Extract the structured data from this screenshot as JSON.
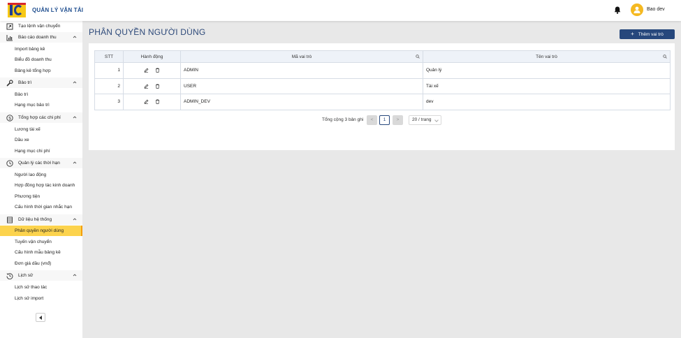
{
  "header": {
    "app_title": "QUẢN LÝ VẬN TẢI",
    "user_name": "Bao dev"
  },
  "sidebar": {
    "top_item": {
      "label": "Tạo lệnh vận chuyển",
      "icon": "export-icon"
    },
    "groups": [
      {
        "label": "Báo cáo doanh thu",
        "icon": "bar-chart-icon",
        "items": [
          "Import bảng kê",
          "Biểu đồ doanh thu",
          "Bảng kê tổng hợp"
        ]
      },
      {
        "label": "Bảo trì",
        "icon": "tool-icon",
        "items": [
          "Bảo trì",
          "Hạng mục bảo trì"
        ]
      },
      {
        "label": "Tổng hợp các chi phí",
        "icon": "dollar-icon",
        "items": [
          "Lương tài xế",
          "Dầu xe",
          "Hạng mục chi phí"
        ]
      },
      {
        "label": "Quản lý các thời hạn",
        "icon": "clock-icon",
        "items": [
          "Người lao động",
          "Hợp đồng hợp tác kinh doanh",
          "Phương tiện",
          "Cấu hình thời gian nhắc hạn"
        ]
      },
      {
        "label": "Dữ liệu hệ thống",
        "icon": "database-icon",
        "items": [
          "Phân quyền người dùng",
          "Tuyến vận chuyển",
          "Cấu hình mẫu bảng kê",
          "Đơn giá dầu (vnđ)"
        ]
      },
      {
        "label": "Lịch sử",
        "icon": "history-icon",
        "items": [
          "Lịch sử thao tác",
          "Lịch sử import"
        ]
      }
    ],
    "active_item": "Phân quyền người dùng"
  },
  "page": {
    "title": "PHÂN QUYỀN NGƯỜI DÙNG",
    "add_button": "Thêm vai trò"
  },
  "table": {
    "columns": [
      "STT",
      "Hành động",
      "Mã vai trò",
      "Tên vai trò"
    ],
    "rows": [
      {
        "stt": "1",
        "code": "ADMIN",
        "name": "Quản lý"
      },
      {
        "stt": "2",
        "code": "USER",
        "name": "Tài xế"
      },
      {
        "stt": "3",
        "code": "ADMIN_DEV",
        "name": "dev"
      }
    ]
  },
  "pagination": {
    "total_text": "Tổng cộng 3 bản ghi",
    "prev": "<",
    "current_page": "1",
    "next": ">",
    "page_size": "20 / trang"
  },
  "colors": {
    "brand": "#26477c",
    "active": "#fcd34d",
    "avatar": "#f5b921"
  }
}
